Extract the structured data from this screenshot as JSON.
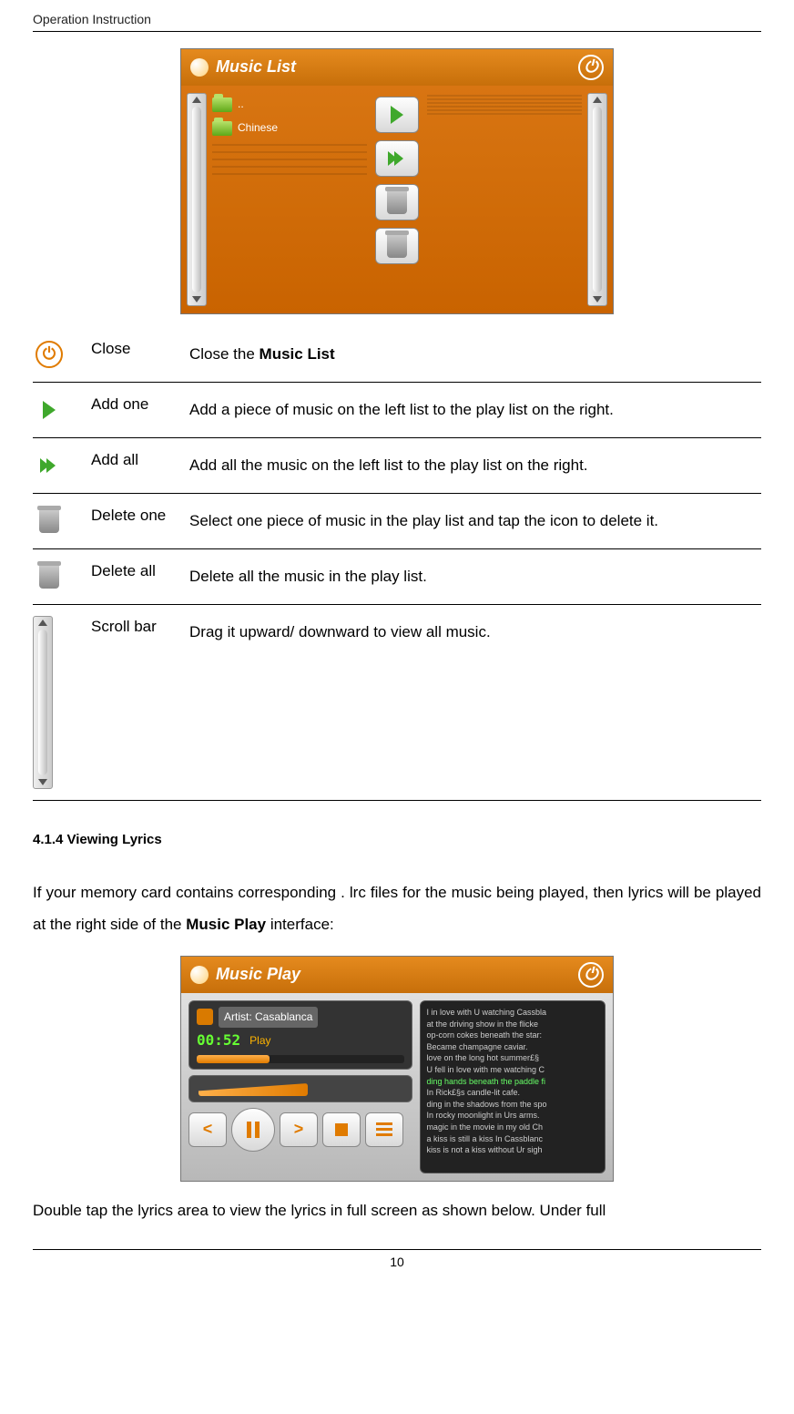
{
  "header": {
    "title": "Operation Instruction"
  },
  "musicList": {
    "title": "Music List",
    "folders": [
      "..",
      "Chinese"
    ]
  },
  "legend": {
    "rows": [
      {
        "name": "Close",
        "desc_pre": "Close the ",
        "bold": "Music List",
        "desc_post": ""
      },
      {
        "name": "Add one",
        "desc_pre": "Add a piece of music on the left list to the play list on the right.",
        "bold": "",
        "desc_post": ""
      },
      {
        "name": "Add all",
        "desc_pre": "Add all the music on the left list to the play list on the right.",
        "bold": "",
        "desc_post": ""
      },
      {
        "name": "Delete one",
        "desc_pre": "Select one piece of music in the play list and tap the icon to delete it.",
        "bold": "",
        "desc_post": ""
      },
      {
        "name": "Delete all",
        "desc_pre": "Delete all the music in the play list.",
        "bold": "",
        "desc_post": ""
      },
      {
        "name": "Scroll bar",
        "desc_pre": "Drag it upward/ downward to view all music.",
        "bold": "",
        "desc_post": ""
      }
    ]
  },
  "section": {
    "heading": "4.1.4 Viewing Lyrics",
    "para1_pre": "If your memory card contains corresponding . lrc files for the music being played, then lyrics will be played at the right side of the ",
    "para1_bold": "Music Play",
    "para1_post": " interface:",
    "para2": "Double tap the lyrics area to view the lyrics in full screen as shown below. Under full"
  },
  "musicPlay": {
    "title": "Music Play",
    "artist_label": "Artist: Casablanca",
    "time": "00:52",
    "status": "Play",
    "lyrics": [
      "I in love with U watching Cassbla",
      "at the driving show in the flicke",
      "op-corn  cokes beneath the star:",
      "Became champagne  caviar.",
      "love on the long hot summer£§",
      "U fell in love with me watching C",
      "ding hands beneath the paddle fi",
      "In Rick£§s candle-lit cafe.",
      "ding in the shadows from the spo",
      "In rocky moonlight in Urs arms.",
      "magic in the movie in my old Ch",
      "a kiss is still a kiss In Cassblanc",
      "kiss is not a kiss without Ur sigh"
    ],
    "lyrics_highlight_index": 6
  },
  "footer": {
    "page": "10"
  }
}
